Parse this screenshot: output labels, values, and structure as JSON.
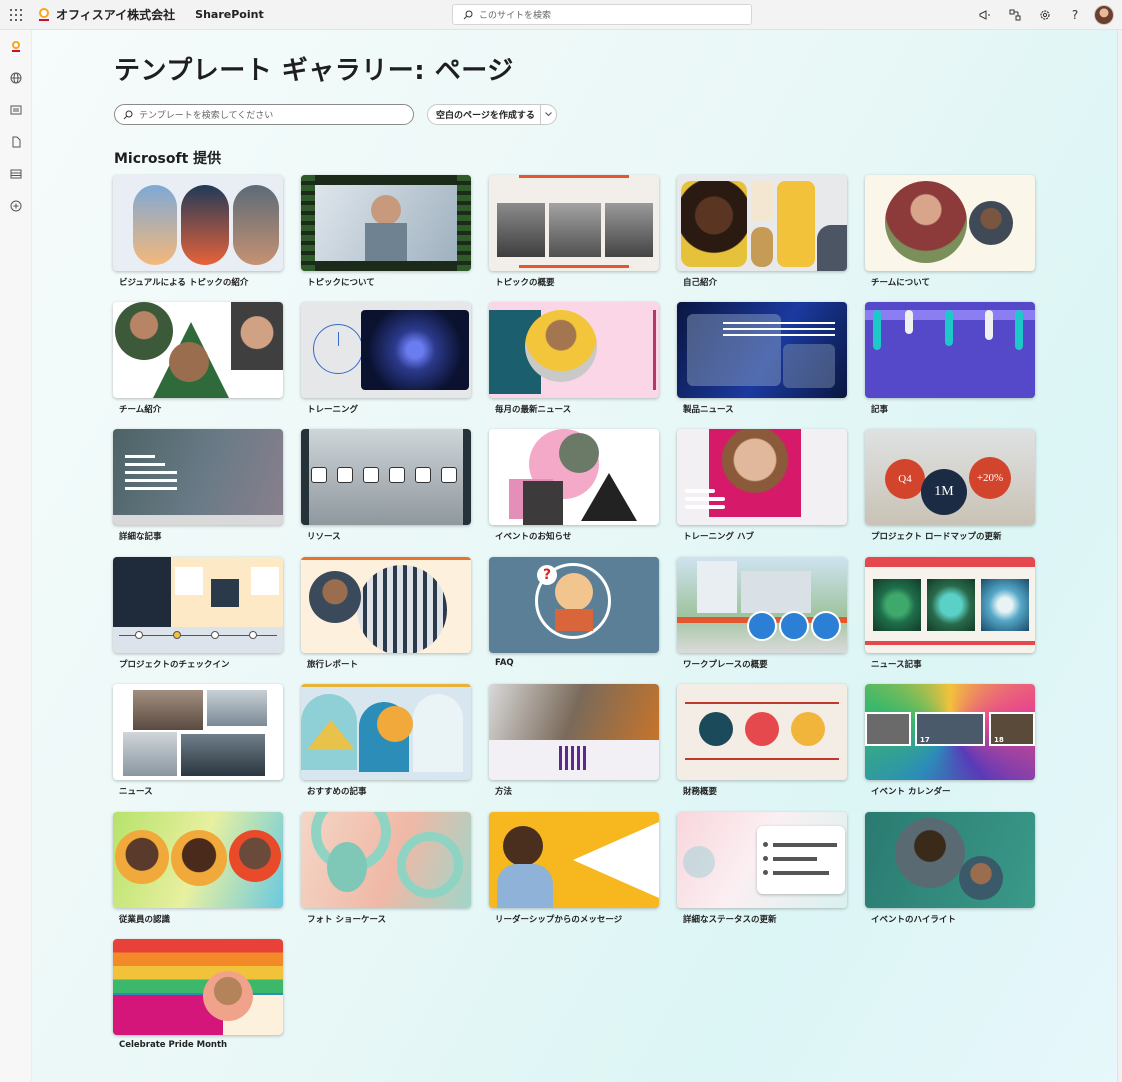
{
  "topbar": {
    "org_name": "オフィスアイ株式会社",
    "app_name": "SharePoint",
    "search_placeholder": "このサイトを検索"
  },
  "page": {
    "title": "テンプレート ギャラリー: ページ",
    "search_placeholder": "テンプレートを検索してください",
    "create_button": "空白のページを作成する",
    "section_title": "Microsoft 提供"
  },
  "templates": [
    {
      "label": "ビジュアルによる トピックの紹介"
    },
    {
      "label": "トピックについて"
    },
    {
      "label": "トピックの概要"
    },
    {
      "label": "自己紹介"
    },
    {
      "label": "チームについて"
    },
    {
      "label": "チーム紹介"
    },
    {
      "label": "トレーニング"
    },
    {
      "label": "毎月の最新ニュース"
    },
    {
      "label": "製品ニュース"
    },
    {
      "label": "記事"
    },
    {
      "label": "詳細な記事"
    },
    {
      "label": "リソース"
    },
    {
      "label": "イベントのお知らせ"
    },
    {
      "label": "トレーニング ハブ"
    },
    {
      "label": "プロジェクト ロードマップの更新",
      "badges": [
        "Q4",
        "1M",
        "+20%"
      ]
    },
    {
      "label": "プロジェクトのチェックイン"
    },
    {
      "label": "旅行レポート"
    },
    {
      "label": "FAQ"
    },
    {
      "label": "ワークプレースの概要"
    },
    {
      "label": "ニュース記事"
    },
    {
      "label": "ニュース"
    },
    {
      "label": "おすすめの記事"
    },
    {
      "label": "方法"
    },
    {
      "label": "財務概要"
    },
    {
      "label": "イベント カレンダー",
      "days": [
        "17",
        "18"
      ]
    },
    {
      "label": "従業員の認識"
    },
    {
      "label": "フォト ショーケース"
    },
    {
      "label": "リーダーシップからのメッセージ"
    },
    {
      "label": "詳細なステータスの更新"
    },
    {
      "label": "イベントのハイライト"
    },
    {
      "label": "Celebrate Pride Month"
    }
  ]
}
